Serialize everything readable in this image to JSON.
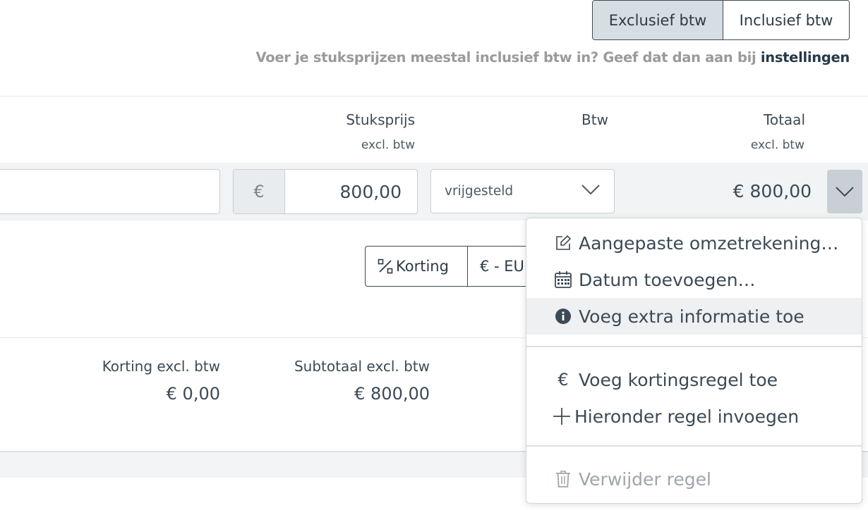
{
  "vat_toggle": {
    "exclusive_label": "Exclusief btw",
    "inclusive_label": "Inclusief btw"
  },
  "hint": {
    "text": "Voer je stuksprijzen meestal inclusief btw in? Geef dat dan aan bij ",
    "link": "instellingen"
  },
  "columns": {
    "unit_price": "Stuksprijs",
    "unit_price_sub": "excl. btw",
    "vat": "Btw",
    "total": "Totaal",
    "total_sub": "excl. btw"
  },
  "line": {
    "currency_symbol": "€",
    "unit_price_value": "800,00",
    "vat_option": "vrijgesteld",
    "total": "€ 800,00"
  },
  "line_buttons": {
    "discount_label": "Korting",
    "currency_label": "€ - EU"
  },
  "totals": {
    "discount_label": "Korting excl. btw",
    "discount_value": "€ 0,00",
    "subtotal_label": "Subtotaal excl. btw",
    "subtotal_value": "€ 800,00"
  },
  "menu": {
    "items": [
      {
        "label": "Aangepaste omzetrekening…",
        "icon": "edit-icon"
      },
      {
        "label": "Datum toevoegen…",
        "icon": "calendar-icon"
      },
      {
        "label": "Voeg extra informatie toe",
        "icon": "info-icon"
      },
      {
        "label": "Voeg kortingsregel toe",
        "icon": "euro-icon"
      },
      {
        "label": "Hieronder regel invoegen",
        "icon": "plus-icon"
      },
      {
        "label": "Verwijder regel",
        "icon": "trash-icon"
      }
    ]
  },
  "colors": {
    "text": "#3c4a55",
    "active_toggle": "#d6dde3",
    "link": "#26384a",
    "muted": "#9a9a9a"
  }
}
